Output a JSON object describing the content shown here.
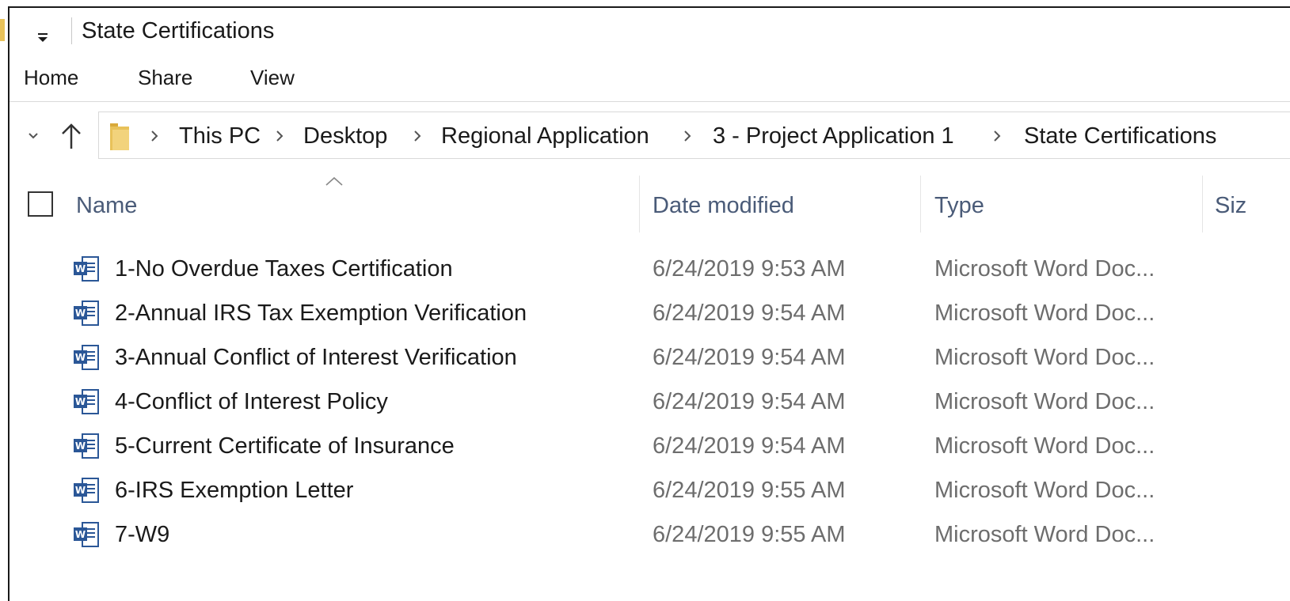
{
  "window": {
    "title": "State Certifications"
  },
  "ribbon": {
    "tabs": [
      "Home",
      "Share",
      "View"
    ]
  },
  "address_bar": {
    "breadcrumbs": [
      "This PC",
      "Desktop",
      "Regional Application",
      "3 - Project Application 1",
      "State Certifications"
    ]
  },
  "columns": {
    "name": "Name",
    "date_modified": "Date modified",
    "type": "Type",
    "size": "Siz"
  },
  "files": [
    {
      "name": "1-No Overdue Taxes Certification",
      "date_modified": "6/24/2019 9:53 AM",
      "type": "Microsoft Word Doc...",
      "icon": "word-document-icon"
    },
    {
      "name": "2-Annual IRS Tax Exemption Verification",
      "date_modified": "6/24/2019 9:54 AM",
      "type": "Microsoft Word Doc...",
      "icon": "word-document-icon"
    },
    {
      "name": "3-Annual Conflict of Interest Verification",
      "date_modified": "6/24/2019 9:54 AM",
      "type": "Microsoft Word Doc...",
      "icon": "word-document-icon"
    },
    {
      "name": "4-Conflict of Interest Policy",
      "date_modified": "6/24/2019 9:54 AM",
      "type": "Microsoft Word Doc...",
      "icon": "word-document-icon"
    },
    {
      "name": "5-Current Certificate of Insurance",
      "date_modified": "6/24/2019 9:54 AM",
      "type": "Microsoft Word Doc...",
      "icon": "word-document-icon"
    },
    {
      "name": "6-IRS Exemption Letter",
      "date_modified": "6/24/2019 9:55 AM",
      "type": "Microsoft Word Doc...",
      "icon": "word-document-icon"
    },
    {
      "name": "7-W9",
      "date_modified": "6/24/2019 9:55 AM",
      "type": "Microsoft Word Doc...",
      "icon": "word-document-icon"
    }
  ],
  "colors": {
    "folder": "#e8c25a",
    "header_text": "#4a5b78",
    "secondary_text": "#6d6d6d",
    "word_blue": "#2b5797"
  }
}
